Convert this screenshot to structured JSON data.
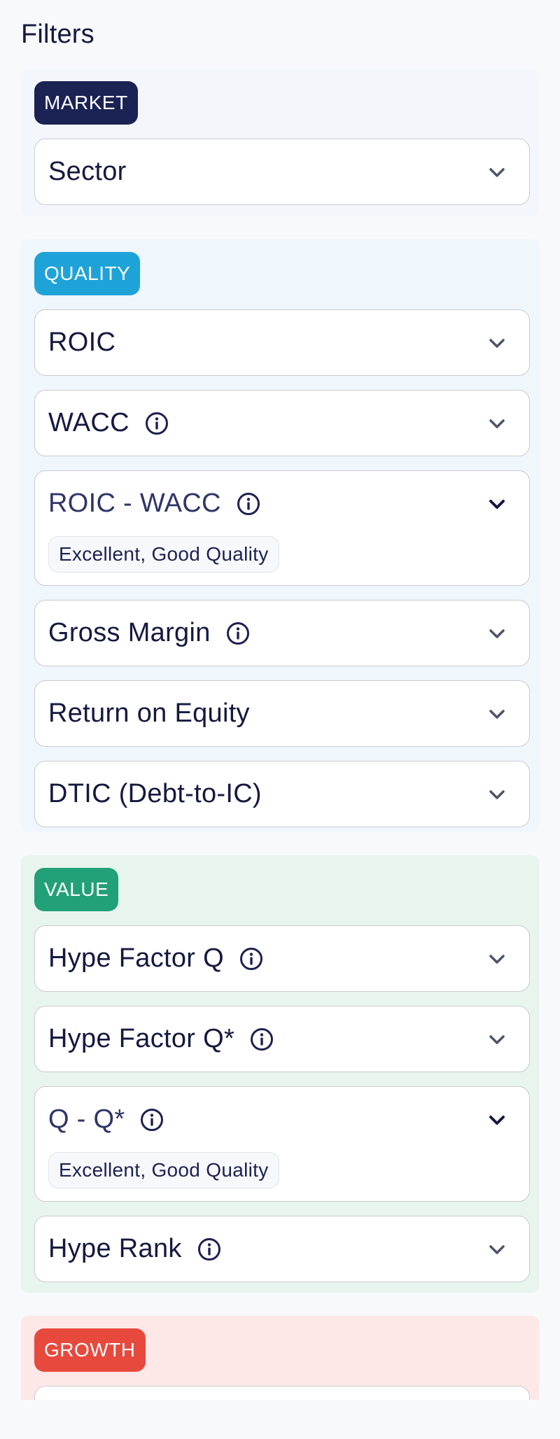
{
  "title": "Filters",
  "groups": {
    "market": {
      "badge": "MARKET",
      "fields": {
        "sector": "Sector"
      }
    },
    "quality": {
      "badge": "QUALITY",
      "fields": {
        "roic": "ROIC",
        "wacc": "WACC",
        "roic_wacc": "ROIC - WACC",
        "roic_wacc_chip": "Excellent, Good Quality",
        "gross_margin": "Gross Margin",
        "return_on_equity": "Return on Equity",
        "dtic": "DTIC (Debt-to-IC)"
      }
    },
    "value": {
      "badge": "VALUE",
      "fields": {
        "hype_factor_q": "Hype Factor Q",
        "hype_factor_q_star": "Hype Factor Q*",
        "q_minus_q_star": "Q - Q*",
        "q_minus_q_star_chip": "Excellent, Good Quality",
        "hype_rank": "Hype Rank"
      }
    },
    "growth": {
      "badge": "GROWTH"
    }
  },
  "colors": {
    "market_badge": "#1b2254",
    "quality_badge": "#1ea3d8",
    "value_badge": "#22a078",
    "growth_badge": "#e8493d",
    "market_bg": "#f3f6fb",
    "quality_bg": "#eff6fc",
    "value_bg": "#e8f4ee",
    "growth_bg": "#fde8e7"
  },
  "icons": {
    "info": "info-circle-icon",
    "chevron": "chevron-down-icon"
  }
}
